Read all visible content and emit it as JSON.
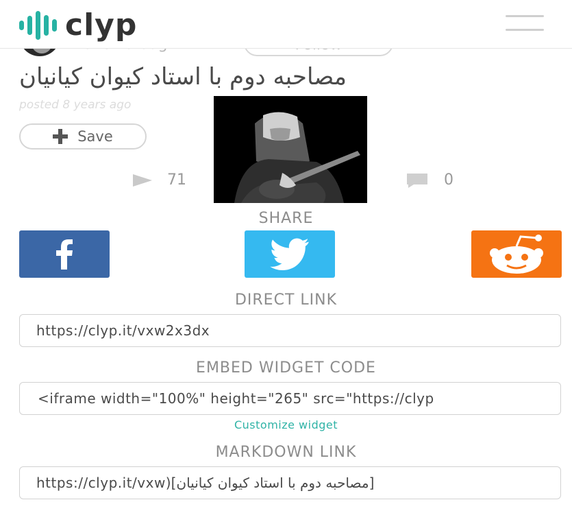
{
  "app": {
    "logo_text": "clyp",
    "brand_color": "#27b2a3"
  },
  "header": {
    "menu_icon": "hamburger-icon"
  },
  "author": {
    "name": "Laris Foroughi",
    "follow_label": "Follow"
  },
  "track": {
    "title": "مصاحبه دوم با استاد کیوان کیانیان",
    "posted": "posted 8 years ago",
    "save_label": "Save",
    "plays": "71",
    "comments": "0"
  },
  "share": {
    "heading": "SHARE",
    "facebook_color": "#3b67a6",
    "twitter_color": "#35b9f0",
    "reddit_color": "#f57313"
  },
  "links": {
    "direct_heading": "DIRECT LINK",
    "direct_value": "https://clyp.it/vxw2x3dx",
    "embed_heading": "EMBED WIDGET CODE",
    "embed_value": "<iframe width=\"100%\" height=\"265\" src=\"https://clyp",
    "customize_label": "Customize widget",
    "markdown_heading": "MARKDOWN LINK",
    "markdown_value": "[مصاحبه دوم با استاد کیوان کیانیان](https://clyp.it/vxw"
  }
}
